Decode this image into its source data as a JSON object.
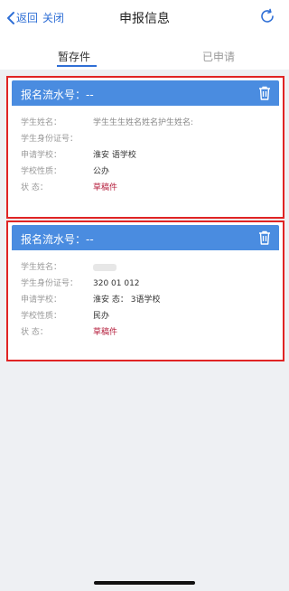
{
  "nav": {
    "back_label": "返回",
    "close_label": "关闭",
    "title": "申报信息"
  },
  "tabs": [
    {
      "label": "暂存件",
      "active": true
    },
    {
      "label": "已申请",
      "active": false
    }
  ],
  "cards": [
    {
      "header": "报名流水号：--",
      "rows": [
        {
          "key": "学生姓名：",
          "value": "学生生生姓名姓名护生姓名:"
        },
        {
          "key": "学生身份证号：",
          "value": ""
        },
        {
          "key": "申请学校：",
          "value": "淮安                语学校"
        },
        {
          "key": "学校性质：",
          "value": "公办"
        },
        {
          "key": "状      态：",
          "value": "草稿件"
        }
      ]
    },
    {
      "header": "报名流水号：--",
      "rows": [
        {
          "key": "学生姓名：",
          "value": ""
        },
        {
          "key": "学生身份证号：",
          "value": "320       01      012"
        },
        {
          "key": "申请学校：",
          "value": "淮安        态：      3语学校"
        },
        {
          "key": "学校性质：",
          "value": "民办"
        },
        {
          "key": "状      态：",
          "value": "草稿件"
        }
      ]
    }
  ],
  "colors": {
    "accent": "#2f6fd6",
    "card_header": "#4a8ce0",
    "highlight_border": "#e02424",
    "status": "#b51e3c"
  },
  "icons": {
    "back": "chevron-left-icon",
    "refresh": "refresh-icon",
    "delete": "trash-icon"
  }
}
